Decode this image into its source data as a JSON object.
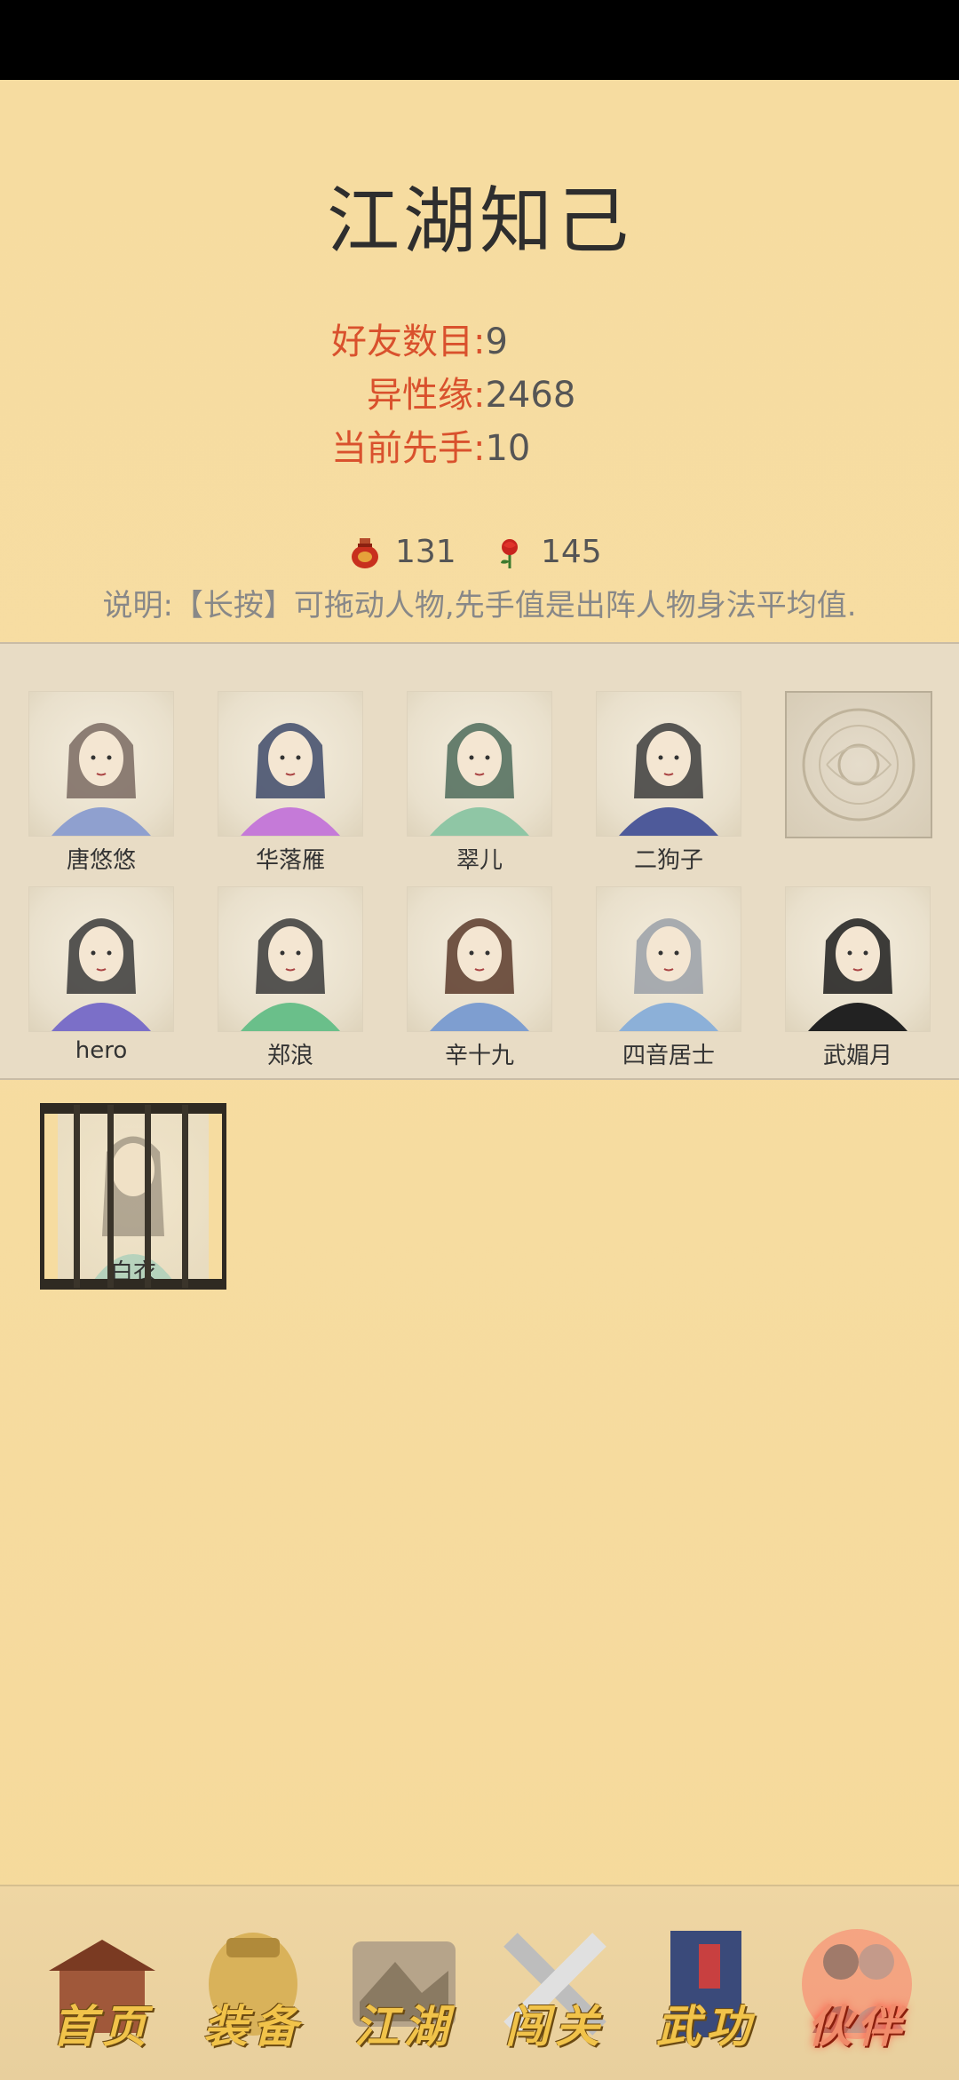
{
  "page": {
    "title": "江湖知己"
  },
  "stats": [
    {
      "label": "好友数目:",
      "value": "9"
    },
    {
      "label": "异性缘:",
      "value": "2468"
    },
    {
      "label": "当前先手:",
      "value": "10"
    }
  ],
  "resources": [
    {
      "icon": "wine-jar-icon",
      "value": "131"
    },
    {
      "icon": "rose-icon",
      "value": "145"
    }
  ],
  "note": "说明:【长按】可拖动人物,先手值是出阵人物身法平均值.",
  "roster": [
    {
      "name": "唐悠悠",
      "hair": "#7a6a62",
      "robe": "#8fa0cf"
    },
    {
      "name": "华落雁",
      "hair": "#3e4a6a",
      "robe": "#c57ad8"
    },
    {
      "name": "翠儿",
      "hair": "#4d6b5b",
      "robe": "#8fc6a5"
    },
    {
      "name": "二狗子",
      "hair": "#3c3c3c",
      "robe": "#4e5a9a"
    },
    {
      "name": "",
      "hair": "",
      "robe": ""
    },
    {
      "name": "hero",
      "hair": "#3a3a3a",
      "robe": "#7b6fc8"
    },
    {
      "name": "郑浪",
      "hair": "#3a3a3a",
      "robe": "#6abf8a"
    },
    {
      "name": "辛十九",
      "hair": "#5a3a2a",
      "robe": "#7e9ed0"
    },
    {
      "name": "四音居士",
      "hair": "#9aa0a8",
      "robe": "#8cb0d8"
    },
    {
      "name": "武媚月",
      "hair": "#1c1c1c",
      "robe": "#222222"
    }
  ],
  "jailed": {
    "name": "白衣"
  },
  "nav": [
    {
      "label": "首页",
      "icon": "house-icon",
      "active": false
    },
    {
      "label": "装备",
      "icon": "armor-icon",
      "active": false
    },
    {
      "label": "江湖",
      "icon": "map-scroll-icon",
      "active": false
    },
    {
      "label": "闯关",
      "icon": "crossed-swords-icon",
      "active": false
    },
    {
      "label": "武功",
      "icon": "martial-book-icon",
      "active": false
    },
    {
      "label": "伙伴",
      "icon": "companions-icon",
      "active": true
    }
  ],
  "colors": {
    "accent": "#d9512d",
    "background": "#f6dca0"
  }
}
